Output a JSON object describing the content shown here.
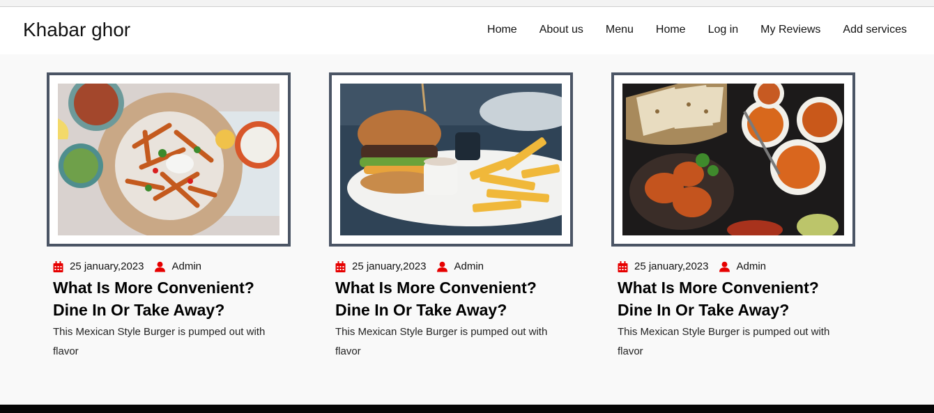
{
  "brand": "Khabar ghor",
  "nav": [
    "Home",
    "About us",
    "Menu",
    "Home",
    "Log in",
    "My Reviews",
    "Add services"
  ],
  "colors": {
    "accent": "#e60000",
    "frame": "#4b5565"
  },
  "posts": [
    {
      "image": "food-platter-fries-photo",
      "icons": {
        "date": "calendar-icon",
        "author": "user-icon"
      },
      "date": "25 january,2023",
      "author": "Admin",
      "title": "What Is More Convenient? Dine In Or Take Away?",
      "excerpt": "This Mexican Style Burger is pumped out with flavor"
    },
    {
      "image": "burger-and-fries-photo",
      "icons": {
        "date": "calendar-icon",
        "author": "user-icon"
      },
      "date": "25 january,2023",
      "author": "Admin",
      "title": "What Is More Convenient? Dine In Or Take Away?",
      "excerpt": "This Mexican Style Burger is pumped out with flavor"
    },
    {
      "image": "naan-and-curry-photo",
      "icons": {
        "date": "calendar-icon",
        "author": "user-icon"
      },
      "date": "25 january,2023",
      "author": "Admin",
      "title": "What Is More Convenient? Dine In Or Take Away?",
      "excerpt": "This Mexican Style Burger is pumped out with flavor"
    }
  ]
}
